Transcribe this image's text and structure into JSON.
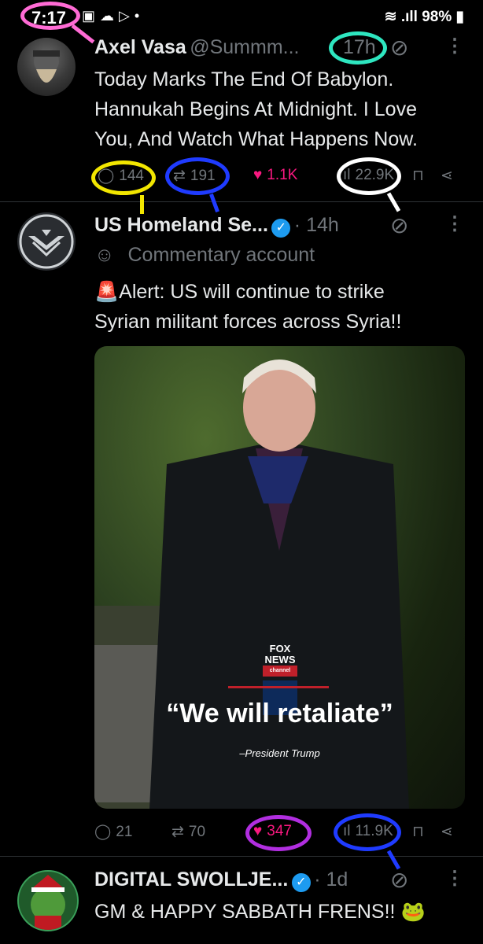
{
  "status_bar": {
    "time": "7:17",
    "battery": "98%"
  },
  "tweets": [
    {
      "name": "Axel Vasa",
      "handle": "@Summm...",
      "time": "17h",
      "text": [
        "Today Marks The End Of Babylon.",
        "Hannukah Begins At Midnight. I Love",
        "You, And Watch What Happens Now."
      ],
      "replies": "144",
      "reposts": "191",
      "likes": "1.1K",
      "views": "22.9K"
    },
    {
      "name": "US Homeland Se...",
      "time": "· 14h",
      "label": "Commentary account",
      "text": [
        "Alert: US will continue to strike",
        "Syrian militant forces across Syria!!"
      ],
      "image_caption": "“We will retaliate”",
      "image_attrib": "–President Trump",
      "image_logo": [
        "FOX",
        "NEWS",
        "channel"
      ],
      "replies": "21",
      "reposts": "70",
      "likes": "347",
      "views": "11.9K"
    },
    {
      "name": "DIGITAL SWOLLJE...",
      "time": "· 1d",
      "text": [
        "GM & HAPPY SABBATH FRENS!! 🐸"
      ]
    }
  ],
  "colors": {
    "annotation_pink": "#ff6bd5",
    "annotation_teal": "#2ee6c0",
    "annotation_yellow": "#f2e600",
    "annotation_blue": "#1f3bff",
    "annotation_white": "#ffffff",
    "annotation_purple": "#b12ee0",
    "like_pink": "#f91880",
    "verified_blue": "#1d9bf0"
  }
}
